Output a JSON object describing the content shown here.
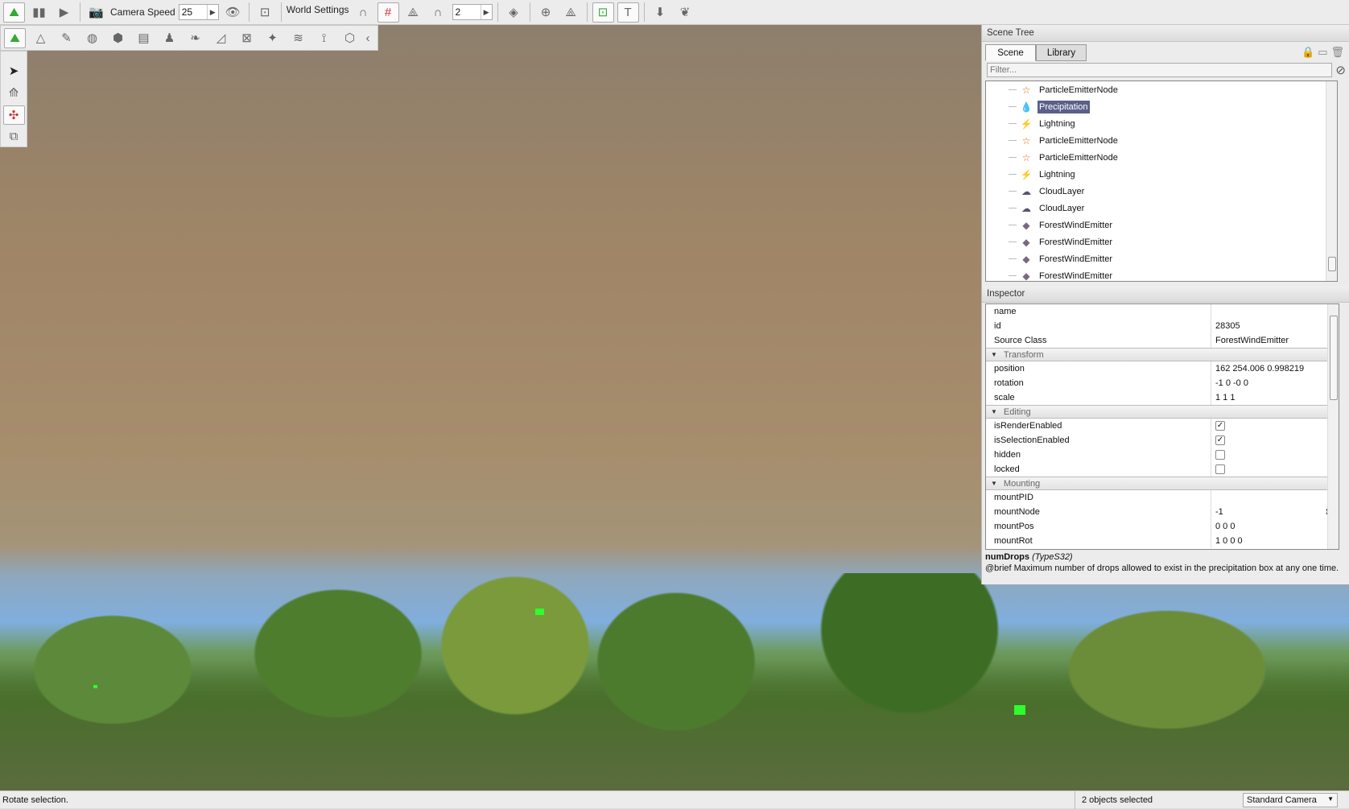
{
  "toolbar": {
    "camera_speed_label": "Camera Speed",
    "camera_speed_value": "25",
    "world_settings_label": "World Settings",
    "snap_value": "2"
  },
  "scene_tree": {
    "title": "Scene Tree",
    "tabs": [
      "Scene",
      "Library"
    ],
    "filter_placeholder": "Filter...",
    "items": [
      {
        "label": "ParticleEmitterNode",
        "icon": "particle-emitter-icon",
        "selected": false
      },
      {
        "label": "Precipitation",
        "icon": "precipitation-drop-icon",
        "selected": true
      },
      {
        "label": "Lightning",
        "icon": "lightning-icon",
        "selected": false
      },
      {
        "label": "ParticleEmitterNode",
        "icon": "particle-emitter-icon",
        "selected": false
      },
      {
        "label": "ParticleEmitterNode",
        "icon": "particle-emitter-icon",
        "selected": false
      },
      {
        "label": "Lightning",
        "icon": "lightning-icon",
        "selected": false
      },
      {
        "label": "CloudLayer",
        "icon": "cloud-layer-icon",
        "selected": false
      },
      {
        "label": "CloudLayer",
        "icon": "cloud-layer-icon",
        "selected": false
      },
      {
        "label": "ForestWindEmitter",
        "icon": "wind-emitter-icon",
        "selected": false
      },
      {
        "label": "ForestWindEmitter",
        "icon": "wind-emitter-icon",
        "selected": false
      },
      {
        "label": "ForestWindEmitter",
        "icon": "wind-emitter-icon",
        "selected": false
      },
      {
        "label": "ForestWindEmitter",
        "icon": "wind-emitter-icon",
        "selected": false
      }
    ]
  },
  "inspector": {
    "title": "Inspector",
    "general": [
      {
        "k": "name",
        "v": ""
      },
      {
        "k": "id",
        "v": "28305"
      },
      {
        "k": "Source Class",
        "v": "ForestWindEmitter"
      }
    ],
    "transform": {
      "title": "Transform",
      "rows": [
        {
          "k": "position",
          "v": "162 254.006 0.998219"
        },
        {
          "k": "rotation",
          "v": "-1 0 -0 0"
        },
        {
          "k": "scale",
          "v": "1 1 1"
        }
      ]
    },
    "editing": {
      "title": "Editing",
      "rows": [
        {
          "k": "isRenderEnabled",
          "checked": true
        },
        {
          "k": "isSelectionEnabled",
          "checked": true
        },
        {
          "k": "hidden",
          "checked": false
        },
        {
          "k": "locked",
          "checked": false
        }
      ]
    },
    "mounting": {
      "title": "Mounting",
      "rows": [
        {
          "k": "mountPID",
          "v": ""
        },
        {
          "k": "mountNode",
          "v": "-1"
        },
        {
          "k": "mountPos",
          "v": "0 0 0"
        },
        {
          "k": "mountRot",
          "v": "1 0 0 0"
        }
      ]
    },
    "help_name": "numDrops",
    "help_type": "(TypeS32)",
    "help_text": "@brief Maximum number of drops allowed to exist in the precipitation box at any one time."
  },
  "status": {
    "message": "Rotate selection.",
    "selection": "2 objects selected",
    "camera": "Standard Camera"
  }
}
